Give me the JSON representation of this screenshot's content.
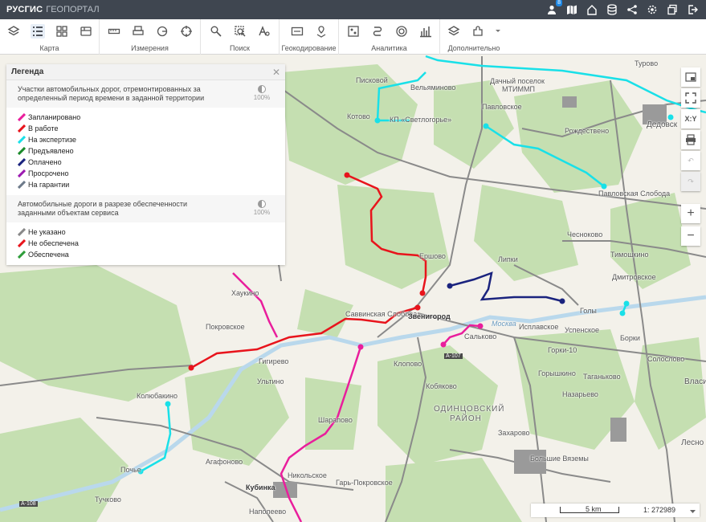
{
  "header": {
    "brand": "РУСГИС",
    "subtitle": "ГЕОПОРТАЛ",
    "notification_count": "8"
  },
  "toolbar": {
    "groups": [
      {
        "label": "Карта"
      },
      {
        "label": "Измерения"
      },
      {
        "label": "Поиск"
      },
      {
        "label": "Геокодирование"
      },
      {
        "label": "Аналитика"
      },
      {
        "label": "Дополнительно"
      }
    ]
  },
  "legend": {
    "title": "Легенда",
    "section1": {
      "text": "Участки автомобильных дорог, отремонтированных за определенный период времени в заданной территории",
      "opacity": "100%"
    },
    "section1_items": [
      {
        "label": "Запланировано",
        "color": "#e91e9c"
      },
      {
        "label": "В работе",
        "color": "#e8141c"
      },
      {
        "label": "На экспертизе",
        "color": "#19e0e8"
      },
      {
        "label": "Предъявлено",
        "color": "#1a8a2a"
      },
      {
        "label": "Оплачено",
        "color": "#1a237e"
      },
      {
        "label": "Просрочено",
        "color": "#9c1ab0"
      },
      {
        "label": "На гарантии",
        "color": "#6d7a8a"
      }
    ],
    "section2": {
      "text": "Автомобильные дороги в разрезе обеспеченности заданными объектам сервиса",
      "opacity": "100%"
    },
    "section2_items": [
      {
        "label": "Не указано",
        "color": "#888888"
      },
      {
        "label": "Не обеспечена",
        "color": "#e8141c"
      },
      {
        "label": "Обеспечена",
        "color": "#2e9d3a"
      }
    ]
  },
  "map_labels": {
    "pischkovo": "Писковой",
    "veliaminovo": "Вельяминово",
    "dachny": "Дачный поселок",
    "mtimmp": "МТИММП",
    "kotovo": "Котово",
    "kp": "КП «Светлогорье»",
    "pavlovskoe": "Павловское",
    "rozhdestveno": "Рождествено",
    "pavlovskaya_sloboda": "Павловская Слобода",
    "dedovsk": "Дедовск",
    "tyrovo": "Турово",
    "ershovo": "Ершово",
    "lipki": "Липки",
    "chesnokovo": "Чесноково",
    "timoshkino": "Тимошкино",
    "dmitrovskoe": "Дмитровское",
    "khaukovo": "Хаукино",
    "pokrovskoe": "Покровское",
    "savvinskaya": "Саввинская Слобода",
    "zvenigorod": "Звенигород",
    "goly": "Голы",
    "ispl": "Исплавское",
    "uspenskoe": "Успенское",
    "borki": "Борки",
    "gorki10": "Горки-10",
    "gilyarevo": "Гигирево",
    "ulitino": "Ультино",
    "klopovo": "Клопово",
    "kobyakovo": "Кобяково",
    "sal": "Сальково",
    "odintsovsky": "ОДИНЦОВСКИЙ",
    "rayon": "РАЙОН",
    "goryshkino": "Горышкино",
    "taganskovo": "Таганьково",
    "nazaryevo": "Назарьево",
    "kolyubakino": "Колюбакино",
    "sharapovo": "Шарапово",
    "zakharovo": "Захарово",
    "bolshie_vyazemy": "Большие Вяземы",
    "agafonovo": "Агафоново",
    "pochye": "Почье",
    "tuchkovo": "Тучково",
    "nikolskoe": "Никольское",
    "kubinka": "Кубинка",
    "grigorevo": "Гарь-Покровское",
    "napalevo": "Наполеево",
    "solovyevo": "Солослово",
    "vlasikha": "Власи",
    "lesnoy": "Лесно",
    "moskva_river": "Москва",
    "a107": "А-107",
    "a108": "А-108"
  },
  "scale": {
    "bar_label": "5 km",
    "ratio": "1: 272989"
  },
  "colors": {
    "forest": "#c5dfb1",
    "road": "#7a7a7a",
    "background": "#f3f1ea",
    "river": "#b9d8ec"
  }
}
